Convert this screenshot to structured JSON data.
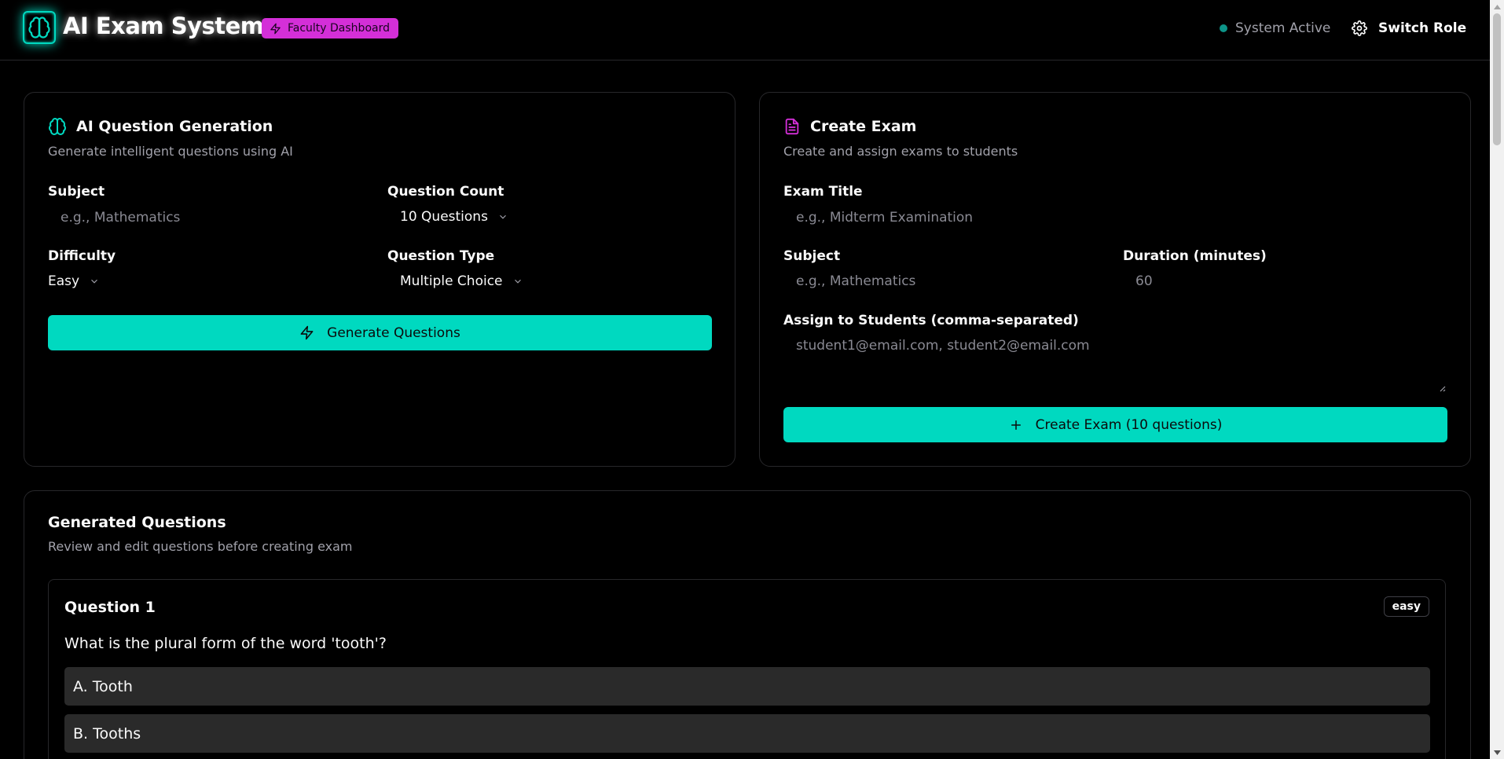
{
  "header": {
    "app_title": "AI Exam System",
    "role_badge": "Faculty Dashboard",
    "status_text": "System Active",
    "switch_role_label": "Switch Role"
  },
  "generation": {
    "title": "AI Question Generation",
    "subtitle": "Generate intelligent questions using AI",
    "subject_label": "Subject",
    "subject_placeholder": "e.g., Mathematics",
    "count_label": "Question Count",
    "count_value": "10 Questions",
    "difficulty_label": "Difficulty",
    "difficulty_value": "Easy",
    "type_label": "Question Type",
    "type_value": "Multiple Choice",
    "generate_button": "Generate Questions"
  },
  "create_exam": {
    "title": "Create Exam",
    "subtitle": "Create and assign exams to students",
    "exam_title_label": "Exam Title",
    "exam_title_placeholder": "e.g., Midterm Examination",
    "subject_label": "Subject",
    "subject_placeholder": "e.g., Mathematics",
    "duration_label": "Duration (minutes)",
    "duration_value": "60",
    "assign_label": "Assign to Students (comma-separated)",
    "assign_placeholder": "student1@email.com, student2@email.com",
    "create_button": "Create Exam (10 questions)"
  },
  "generated": {
    "title": "Generated Questions",
    "subtitle": "Review and edit questions before creating exam",
    "questions": [
      {
        "title": "Question 1",
        "difficulty": "easy",
        "text": "What is the plural form of the word 'tooth'?",
        "options": [
          "A. Tooth",
          "B. Tooths"
        ]
      }
    ]
  },
  "colors": {
    "accent": "#00d9c0",
    "badge": "#d42fd8",
    "background": "#000000",
    "border": "#27272a",
    "status_dot": "#0d9488"
  },
  "icons": {
    "logo": "brain-icon",
    "badge": "lightning-icon",
    "switch_role": "gear-icon",
    "generation": "brain-icon",
    "create_exam": "document-icon",
    "generate": "lightning-icon",
    "create": "plus-icon"
  }
}
